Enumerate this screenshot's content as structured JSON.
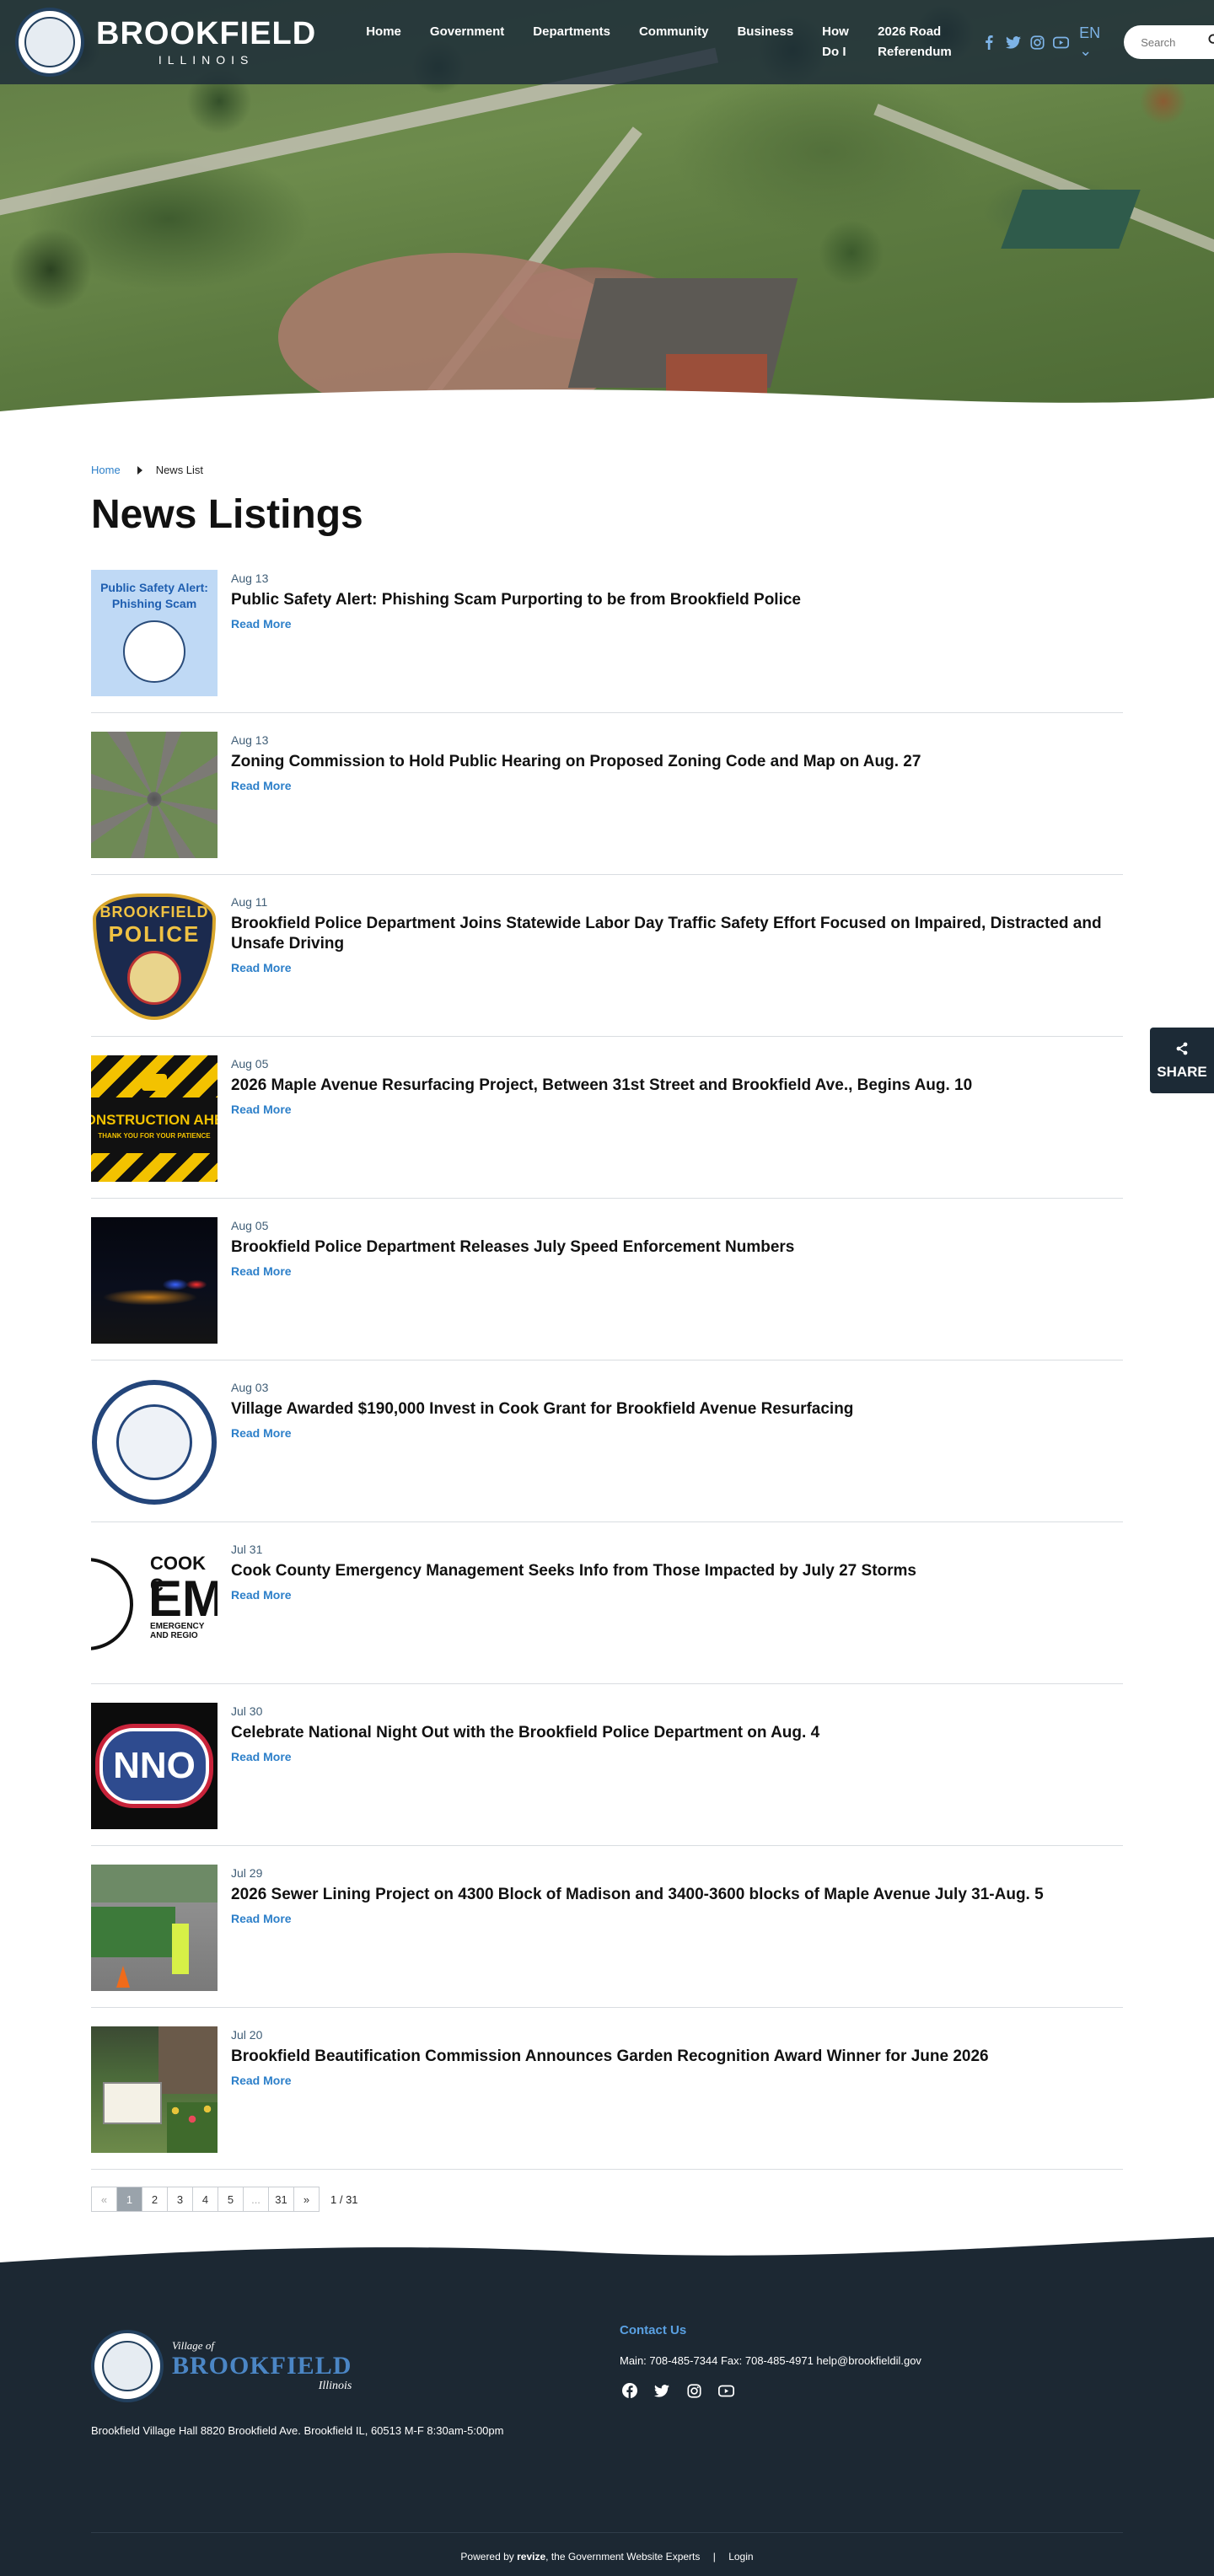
{
  "header": {
    "brand_name": "BROOKFIELD",
    "brand_state": "ILLINOIS",
    "nav": [
      {
        "label": "Home"
      },
      {
        "label": "Government"
      },
      {
        "label": "Departments"
      },
      {
        "label": "Community"
      },
      {
        "label": "Business"
      },
      {
        "label": "How Do I"
      },
      {
        "label": "2026 Road Referendum"
      }
    ],
    "social_icons": [
      "facebook-icon",
      "twitter-icon",
      "instagram-icon",
      "youtube-icon"
    ],
    "language": "EN",
    "search_placeholder": "Search"
  },
  "breadcrumb": {
    "home": "Home",
    "current": "News List"
  },
  "page_title": "News Listings",
  "read_more_label": "Read More",
  "news": [
    {
      "date": "Aug 13",
      "title": "Public Safety Alert: Phishing Scam Purporting to be from Brookfield Police",
      "thumb": "alert",
      "thumb_text": "Public Safety Alert: Phishing Scam"
    },
    {
      "date": "Aug 13",
      "title": "Zoning Commission to Hold Public Hearing on Proposed Zoning Code and Map on Aug. 27",
      "thumb": "aerial"
    },
    {
      "date": "Aug 11",
      "title": "Brookfield Police Department Joins Statewide Labor Day Traffic Safety Effort Focused on Impaired, Distracted and Unsafe Driving",
      "thumb": "badge",
      "thumb_text": [
        "BROOKFIELD",
        "POLICE"
      ]
    },
    {
      "date": "Aug 05",
      "title": "2026 Maple Avenue Resurfacing Project, Between 31st Street and Brookfield Ave., Begins Aug. 10",
      "thumb": "construction",
      "thumb_text": [
        "CONSTRUCTION AHEA",
        "THANK YOU FOR YOUR PATIENCE"
      ]
    },
    {
      "date": "Aug 05",
      "title": "Brookfield Police Department Releases July Speed Enforcement Numbers",
      "thumb": "night"
    },
    {
      "date": "Aug 03",
      "title": "Village Awarded $190,000 Invest in Cook Grant for Brookfield Avenue Resurfacing",
      "thumb": "village"
    },
    {
      "date": "Jul 31",
      "title": "Cook County Emergency Management Seeks Info from Those Impacted by July 27 Storms",
      "thumb": "cook",
      "thumb_text": [
        "COOK C",
        "EM",
        "EMERGENCY",
        "AND REGIO"
      ]
    },
    {
      "date": "Jul 30",
      "title": "Celebrate National Night Out with the Brookfield Police Department on Aug. 4",
      "thumb": "nno",
      "thumb_text": "NNO"
    },
    {
      "date": "Jul 29",
      "title": "2026 Sewer Lining Project on 4300 Block of Madison and 3400-3600 blocks of Maple Avenue July 31-Aug. 5",
      "thumb": "sewer"
    },
    {
      "date": "Jul 20",
      "title": "Brookfield Beautification Commission Announces Garden Recognition Award Winner for June 2026",
      "thumb": "garden"
    }
  ],
  "pagination": {
    "prev": "«",
    "pages": [
      "1",
      "2",
      "3",
      "4",
      "5",
      "...",
      "31"
    ],
    "next": "»",
    "current": "1",
    "count": "1 / 31"
  },
  "share_label": "SHARE",
  "footer": {
    "village_of": "Village of",
    "name": "BROOKFIELD",
    "state": "Illinois",
    "address": "Brookfield Village Hall 8820 Brookfield Ave. Brookfield IL, 60513 M-F 8:30am-5:00pm",
    "contact_heading": "Contact Us",
    "phones": "Main: 708-485-7344 Fax: 708-485-4971 help@brookfieldil.gov",
    "social_icons": [
      "facebook-icon",
      "twitter-icon",
      "instagram-icon",
      "youtube-icon"
    ],
    "powered_by": "Powered by",
    "powered_brand": "revize",
    "powered_suffix": ", the Government Website Experts",
    "separator": "|",
    "login": "Login"
  },
  "colors": {
    "header_bg": "#1b2a38",
    "accent_blue": "#2c7fc9",
    "footer_bg": "#1c2833",
    "contact_blue": "#5aa1e3"
  }
}
